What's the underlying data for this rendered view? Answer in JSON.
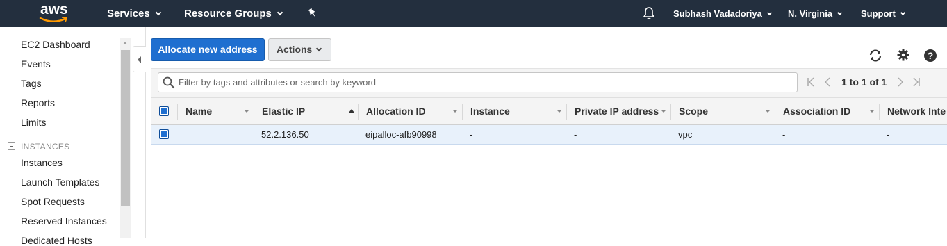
{
  "topnav": {
    "logo": "aws",
    "services": "Services",
    "resource_groups": "Resource Groups",
    "user": "Subhash Vadadoriya",
    "region": "N. Virginia",
    "support": "Support"
  },
  "sidebar": {
    "links_top": [
      "EC2 Dashboard",
      "Events",
      "Tags",
      "Reports",
      "Limits"
    ],
    "section_instances": "INSTANCES",
    "links_instances": [
      "Instances",
      "Launch Templates",
      "Spot Requests",
      "Reserved Instances",
      "Dedicated Hosts"
    ]
  },
  "toolbar": {
    "allocate_label": "Allocate new address",
    "actions_label": "Actions"
  },
  "filter": {
    "placeholder": "Filter by tags and attributes or search by keyword",
    "pager_text": "1 to 1 of 1"
  },
  "table": {
    "columns": [
      "Name",
      "Elastic IP",
      "Allocation ID",
      "Instance",
      "Private IP address",
      "Scope",
      "Association ID",
      "Network Inte"
    ],
    "rows": [
      {
        "name": "",
        "elastic_ip": "52.2.136.50",
        "allocation_id": "eipalloc-afb90998",
        "instance": "-",
        "private_ip": "-",
        "scope": "vpc",
        "association_id": "-",
        "network_interface": "-"
      }
    ]
  },
  "colors": {
    "nav_bg": "#232f3e",
    "primary": "#1f6fd0",
    "selected_row": "#e8f1fb"
  }
}
